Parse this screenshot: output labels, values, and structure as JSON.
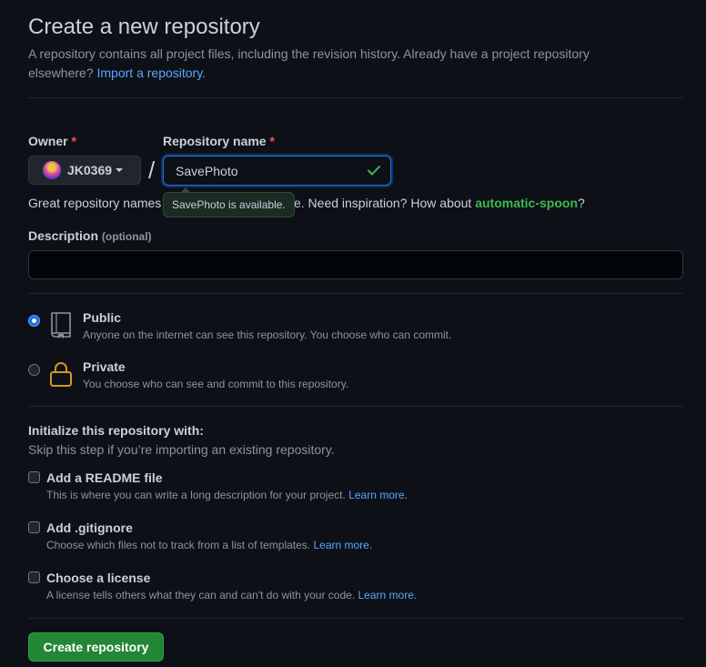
{
  "header": {
    "title": "Create a new repository",
    "subtitle": "A repository contains all project files, including the revision history. Already have a project repository elsewhere?",
    "import_link": "Import a repository."
  },
  "owner": {
    "label": "Owner",
    "required_mark": "*",
    "value": "JK0369"
  },
  "separator": "/",
  "repo_name": {
    "label": "Repository name",
    "required_mark": "*",
    "value": "SavePhoto",
    "tooltip": "SavePhoto is available."
  },
  "hint": {
    "prefix": "Great repository names",
    "middle": "able. Need inspiration? How about",
    "suggestion": "automatic-spoon",
    "suffix": "?"
  },
  "description": {
    "label": "Description",
    "optional": "(optional)",
    "value": ""
  },
  "visibility": {
    "public": {
      "title": "Public",
      "desc": "Anyone on the internet can see this repository. You choose who can commit.",
      "checked": true
    },
    "private": {
      "title": "Private",
      "desc": "You choose who can see and commit to this repository.",
      "checked": false
    }
  },
  "init": {
    "title": "Initialize this repository with:",
    "subtitle": "Skip this step if you’re importing an existing repository.",
    "options": [
      {
        "title": "Add a README file",
        "desc": "This is where you can write a long description for your project.",
        "link": "Learn more."
      },
      {
        "title": "Add .gitignore",
        "desc": "Choose which files not to track from a list of templates.",
        "link": "Learn more."
      },
      {
        "title": "Choose a license",
        "desc": "A license tells others what they can and can't do with your code.",
        "link": "Learn more."
      }
    ]
  },
  "submit_label": "Create repository",
  "colors": {
    "background": "#0d1117",
    "accent_blue": "#58a6ff",
    "success_green": "#3fb950",
    "button_green": "#238636",
    "required_red": "#f85149",
    "lock_orange": "#d29922"
  },
  "icons": {
    "check": "check-icon",
    "public": "repo-icon",
    "private": "lock-icon",
    "owner": "avatar",
    "dropdown": "caret-down-icon"
  }
}
